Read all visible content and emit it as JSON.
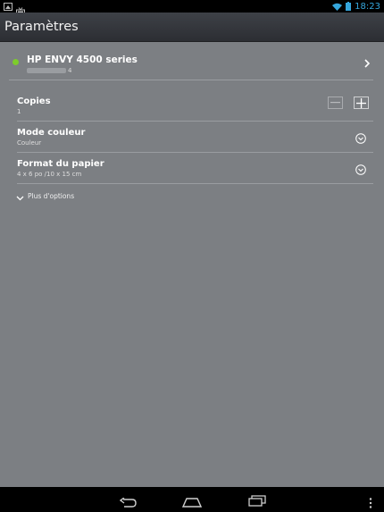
{
  "status_bar": {
    "time": "18:23",
    "left_icons": [
      "image-icon",
      "tv-icon"
    ],
    "right_icons": [
      "wifi-icon",
      "battery-icon"
    ],
    "accent_color": "#35a6dc"
  },
  "action_bar": {
    "title": "Paramètres"
  },
  "printer": {
    "name": "HP ENVY 4500 series",
    "subtitle": "4",
    "status_color": "#7dcc2a"
  },
  "settings": {
    "copies": {
      "label": "Copies",
      "value": "1"
    },
    "color_mode": {
      "label": "Mode couleur",
      "value": "Couleur"
    },
    "paper_size": {
      "label": "Format du papier",
      "value": "4 x 6 po /10 x 15 cm"
    }
  },
  "more_options": {
    "label": "Plus d'options"
  },
  "nav_bar": {
    "buttons": [
      "back-icon",
      "home-icon",
      "recents-icon",
      "overflow-menu-icon"
    ]
  }
}
